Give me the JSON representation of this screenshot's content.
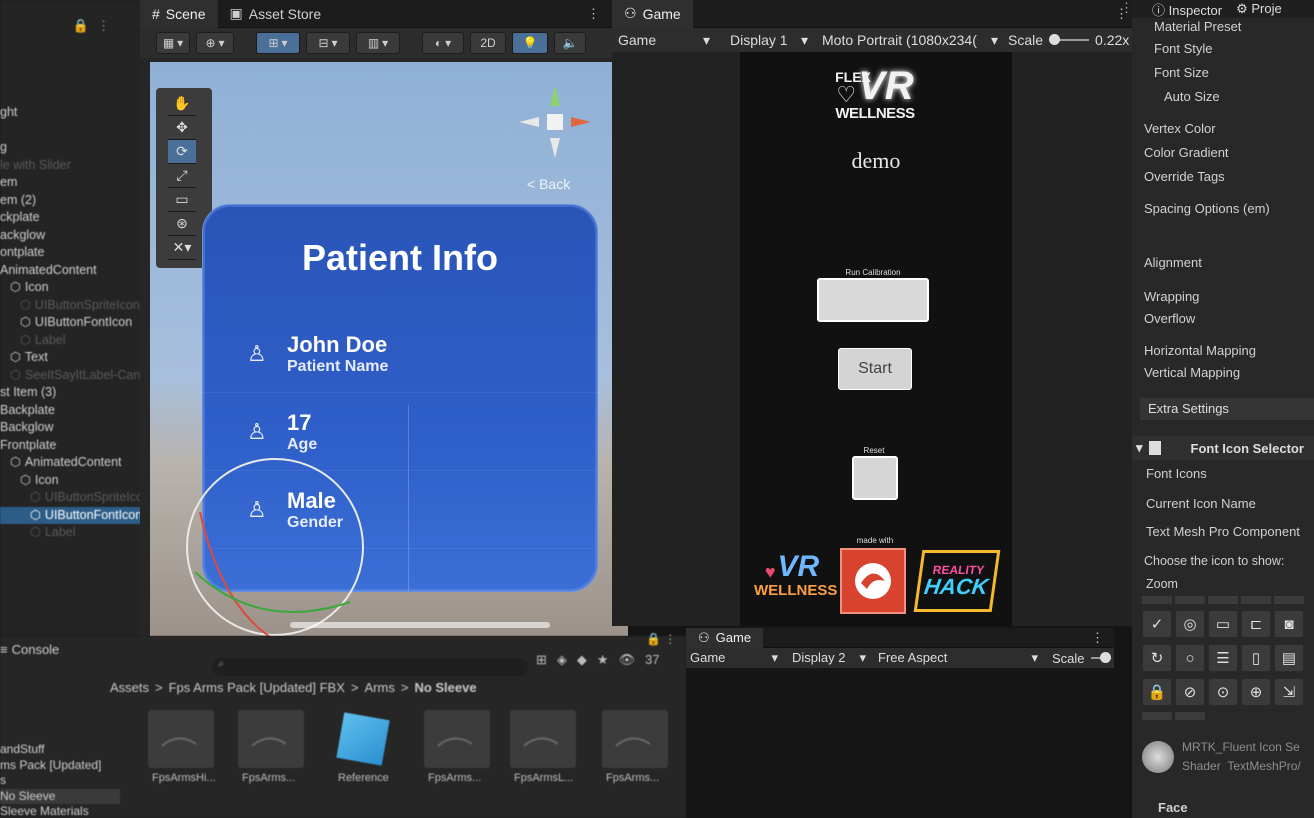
{
  "hierarchy": {
    "rows": [
      {
        "text": "ght",
        "style": "normal",
        "indent": 0
      },
      {
        "text": "",
        "style": "normal",
        "indent": 0
      },
      {
        "text": "g",
        "style": "normal",
        "indent": 0
      },
      {
        "text": "le with Slider",
        "style": "dim",
        "indent": 0
      },
      {
        "text": "em",
        "style": "normal",
        "indent": 0
      },
      {
        "text": "em (2)",
        "style": "normal",
        "indent": 0
      },
      {
        "text": "ckplate",
        "style": "normal",
        "indent": 0
      },
      {
        "text": "ackglow",
        "style": "normal",
        "indent": 0
      },
      {
        "text": "ontplate",
        "style": "normal",
        "indent": 0
      },
      {
        "text": "AnimatedContent",
        "style": "normal",
        "indent": 0
      },
      {
        "text": "Icon",
        "style": "normal",
        "indent": 1
      },
      {
        "text": "UIButtonSpriteIcon",
        "style": "dim",
        "indent": 2
      },
      {
        "text": "UIButtonFontIcon",
        "style": "normal",
        "indent": 2
      },
      {
        "text": "Label",
        "style": "dim",
        "indent": 2
      },
      {
        "text": "Text",
        "style": "normal",
        "indent": 1
      },
      {
        "text": "SeeItSayItLabel-Canvas",
        "style": "dim",
        "indent": 1
      },
      {
        "text": "st Item (3)",
        "style": "normal",
        "indent": 0
      },
      {
        "text": "Backplate",
        "style": "normal",
        "indent": 0
      },
      {
        "text": "Backglow",
        "style": "normal",
        "indent": 0
      },
      {
        "text": "Frontplate",
        "style": "normal",
        "indent": 0
      },
      {
        "text": "AnimatedContent",
        "style": "normal",
        "indent": 1
      },
      {
        "text": "Icon",
        "style": "normal",
        "indent": 2
      },
      {
        "text": "UIButtonSpriteIcon",
        "style": "dim",
        "indent": 3
      },
      {
        "text": "UIButtonFontIcon",
        "style": "selected",
        "indent": 3
      },
      {
        "text": "Label",
        "style": "dim",
        "indent": 3
      }
    ]
  },
  "scene": {
    "tab_scene": "Scene",
    "tab_asset_store": "Asset Store",
    "toolbar": {
      "btn_2d": "2D"
    },
    "back_label": "< Back",
    "card": {
      "title": "Patient Info",
      "fields": [
        {
          "value": "John Doe",
          "label": "Patient Name"
        },
        {
          "value": "17",
          "label": "Age"
        },
        {
          "value": "Male",
          "label": "Gender"
        }
      ]
    }
  },
  "game": {
    "tab": "Game",
    "toolbar": {
      "game": "Game",
      "display": "Display 1",
      "resolution": "Moto Portrait (1080x234(",
      "scale_label": "Scale",
      "scale_value": "0.22x"
    },
    "phone": {
      "logo_line1": "FLEX",
      "logo_line2": "VR",
      "logo_line3": "WELLNESS",
      "demo": "demo",
      "run_calibration": "Run Calibration",
      "start": "Start",
      "reset": "Reset",
      "made_with": "made with",
      "bottom_logo_text": "FLEX VR WELLNESS",
      "reality_hack_1": "REALITY",
      "reality_hack_2": "HACK"
    }
  },
  "game2": {
    "tab": "Game",
    "toolbar": {
      "game": "Game",
      "display": "Display 2",
      "aspect": "Free Aspect",
      "scale_label": "Scale"
    }
  },
  "inspector": {
    "tab_inspector": "Inspector",
    "tab_project": "Proje",
    "rows": [
      {
        "label": "Material Preset",
        "indent": 2
      },
      {
        "label": "Font Style",
        "indent": 2
      },
      {
        "label": "Font Size",
        "indent": 2
      },
      {
        "label": "Auto Size",
        "indent": 3
      },
      {
        "label": "Vertex Color",
        "indent": 1
      },
      {
        "label": "Color Gradient",
        "indent": 1
      },
      {
        "label": "Override Tags",
        "indent": 1
      },
      {
        "label": "Spacing Options (em)",
        "indent": 1
      },
      {
        "label": "Alignment",
        "indent": 1
      },
      {
        "label": "Wrapping",
        "indent": 1
      },
      {
        "label": "Overflow",
        "indent": 1
      },
      {
        "label": "Horizontal Mapping",
        "indent": 1
      },
      {
        "label": "Vertical Mapping",
        "indent": 1
      }
    ],
    "extra_settings": "Extra Settings",
    "font_icon_selector": {
      "title": "Font Icon Selector",
      "font_icons": "Font Icons",
      "current_icon_name": "Current Icon Name",
      "text_mesh_pro_component": "Text Mesh Pro Component",
      "choose_icon": "Choose the icon to show:",
      "zoom": "Zoom"
    },
    "material": {
      "name": "MRTK_Fluent Icon Se",
      "shader_label": "Shader",
      "shader_value": "TextMeshPro/",
      "face": "Face"
    }
  },
  "console": {
    "tab": "Console",
    "search_count": "37"
  },
  "project": {
    "breadcrumb": [
      "Assets",
      "Fps Arms Pack [Updated] FBX",
      "Arms",
      "No Sleeve"
    ],
    "left_tree": [
      "andStuff",
      "ms Pack [Updated]",
      "s",
      "No Sleeve",
      "Sleeve Materials"
    ],
    "assets": [
      "FpsArmsHi...",
      "FpsArms...",
      "Reference",
      "FpsArms...",
      "FpsArmsL...",
      "FpsArms..."
    ]
  },
  "colors": {
    "accent_selection": "#2c5d87",
    "card_blue": "#2a55b8",
    "scene_sky": "#8fb0d6"
  }
}
